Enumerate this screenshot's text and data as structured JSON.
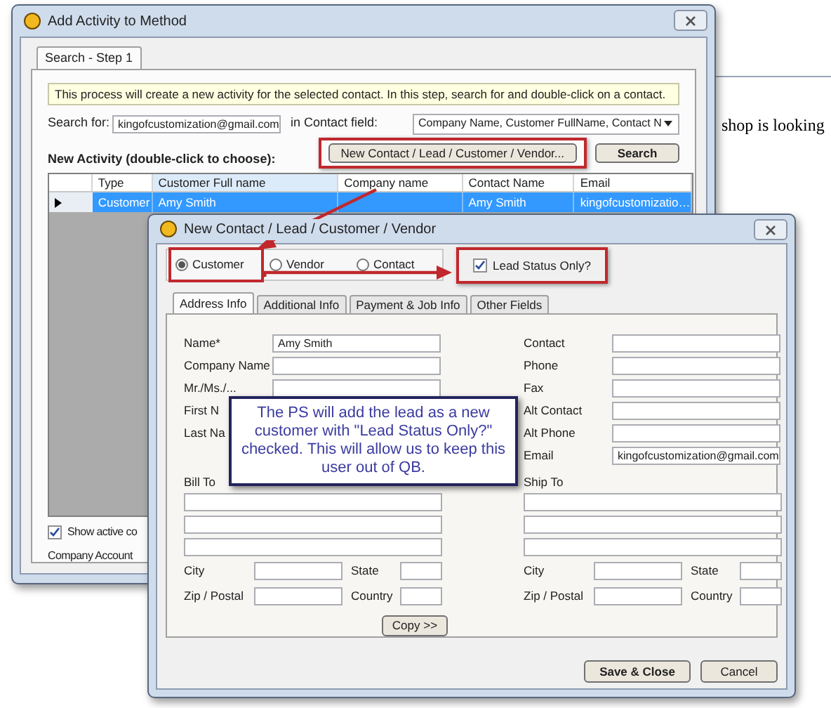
{
  "background_document": {
    "text": "shop is looking"
  },
  "search_window": {
    "title": "Add Activity to Method",
    "tabs": [
      {
        "label": "Search - Step 1",
        "selected": true
      }
    ],
    "info": "This process will create a new activity for the selected contact. In this step, search for and double-click on a contact.",
    "search_label": "Search for:",
    "search_value": "kingofcustomization@gmail.com",
    "field_label": "in Contact field:",
    "field_value": "Company Name, Customer FullName, Contact N",
    "list_label": "New Activity (double-click to choose):",
    "buttons": [
      {
        "label": "New Contact / Lead / Customer / Vendor...",
        "highlighted": true
      },
      {
        "label": "Search",
        "highlighted": false
      }
    ],
    "columns": [
      "Type",
      "Customer Full name",
      "Company name",
      "Contact Name",
      "Email"
    ],
    "rows": [
      {
        "type": "Customer",
        "customer_full_name": "Amy Smith",
        "contact_name": "Amy Smith",
        "email": "kingofcustomizatio…",
        "selected": true
      }
    ],
    "show_active": {
      "label": "Show active co",
      "checked": true
    },
    "company_account_label": "Company Account"
  },
  "contact_window": {
    "title": "New Contact / Lead / Customer / Vendor",
    "types": [
      {
        "label": "Customer",
        "selected": true,
        "highlighted": true
      },
      {
        "label": "Vendor",
        "selected": false,
        "highlighted": false
      },
      {
        "label": "Contact",
        "selected": false,
        "highlighted": false
      }
    ],
    "lead_status": {
      "label": "Lead Status Only?",
      "checked": true,
      "highlighted": true
    },
    "tabs": [
      {
        "label": "Address Info",
        "selected": true
      },
      {
        "label": "Additional Info",
        "selected": false
      },
      {
        "label": "Payment & Job Info",
        "selected": false
      },
      {
        "label": "Other Fields",
        "selected": false
      }
    ],
    "left_fields": [
      {
        "label": "Name*",
        "kind": "field",
        "value": "Amy Smith"
      },
      {
        "label": "Company Name",
        "kind": "field"
      },
      {
        "label": "Mr./Ms./...",
        "kind": "field"
      },
      {
        "label": "First N",
        "kind": "label"
      },
      {
        "label": "Last Na",
        "kind": "label"
      }
    ],
    "right_fields": [
      {
        "label": "Contact",
        "kind": "field"
      },
      {
        "label": "Phone",
        "kind": "field"
      },
      {
        "label": "Fax",
        "kind": "field"
      },
      {
        "label": "Alt Contact",
        "kind": "field"
      },
      {
        "label": "Alt Phone",
        "kind": "field"
      },
      {
        "label": "Email",
        "kind": "field",
        "value": "kingofcustomization@gmail.com"
      }
    ],
    "bill_to": {
      "label": "Bill To",
      "city": "City",
      "state": "State",
      "zip": "Zip / Postal",
      "country": "Country"
    },
    "ship_to": {
      "label": "Ship To",
      "city": "City",
      "state": "State",
      "zip": "Zip / Postal",
      "country": "Country"
    },
    "copy_button": "Copy >>",
    "buttons": [
      "Save & Close",
      "Cancel"
    ]
  },
  "callout": "The PS will add the lead as a new customer with \"Lead Status Only?\" checked. This will allow us to keep this user out of QB."
}
